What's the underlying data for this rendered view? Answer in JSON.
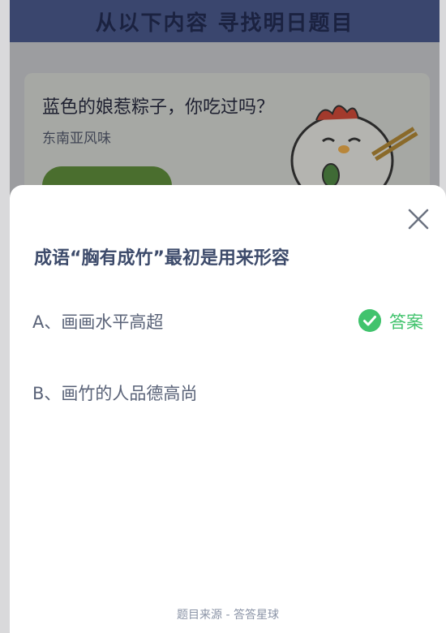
{
  "background": {
    "header_title": "从以下内容 寻找明日题目",
    "card_title": "蓝色的娘惹粽子，你吃过吗？",
    "card_subtitle": "东南亚风味"
  },
  "quiz": {
    "question": "成语“胸有成竹”最初是用来形容",
    "options": [
      {
        "label": "A、画画水平高超",
        "is_answer": true
      },
      {
        "label": "B、画竹的人品德高尚",
        "is_answer": false
      }
    ],
    "answer_label": "答案",
    "footer": "题目来源 - 答答星球"
  },
  "colors": {
    "accent_green": "#41c36d",
    "question_text": "#3d4b6b",
    "header_bg": "#3a466e"
  },
  "icons": {
    "close": "close-icon",
    "check": "check-circle-icon",
    "mascot": "chicken-mascot-icon"
  }
}
